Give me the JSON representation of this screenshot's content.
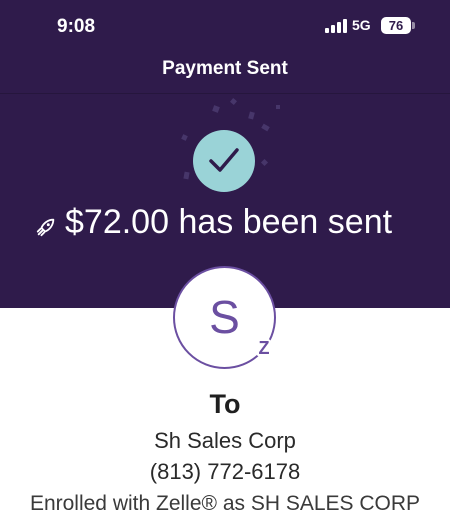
{
  "status_bar": {
    "time": "9:08",
    "network": "5G",
    "battery": "76"
  },
  "header": {
    "title": "Payment Sent"
  },
  "confirmation": {
    "icon": "checkmark-icon",
    "message": "$72.00 has been sent",
    "message_icon": "rocket-icon"
  },
  "recipient": {
    "avatar_initial": "S",
    "badge_icon": "zelle-icon",
    "badge_glyph": "Z",
    "to_label": "To",
    "name": "Sh Sales Corp",
    "phone": "(813) 772-6178",
    "enrolled": "Enrolled with Zelle® as SH SALES CORP"
  },
  "colors": {
    "header_bg": "#2f1b4b",
    "accent": "#6b4fa1",
    "check_bg": "#9ad3d7"
  }
}
